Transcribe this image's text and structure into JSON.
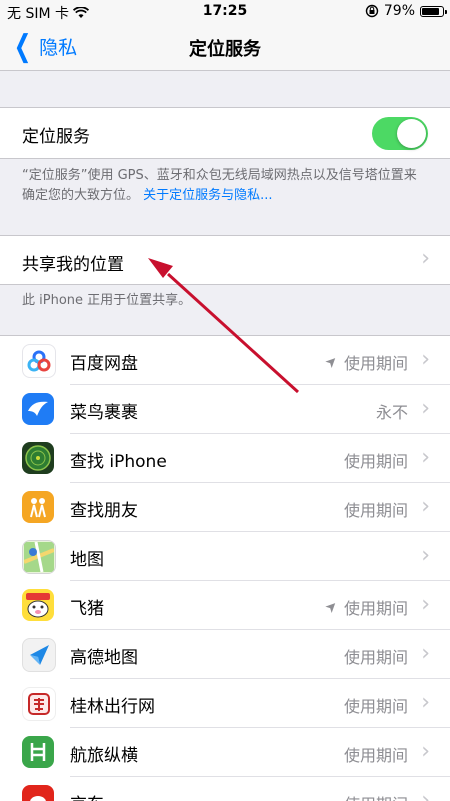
{
  "status_bar": {
    "carrier": "无 SIM 卡",
    "time": "17:25",
    "battery": "79%",
    "battery_level": 0.79
  },
  "nav": {
    "back_label": "隐私",
    "title": "定位服务"
  },
  "location_services": {
    "label": "定位服务",
    "toggle_on": true,
    "footnote": "“定位服务”使用 GPS、蓝牙和众包无线局域网热点以及信号塔位置来确定您的大致方位。",
    "footnote_link": "关于定位服务与隐私..."
  },
  "share_location": {
    "label": "共享我的位置",
    "footnote": "此 iPhone 正用于位置共享。"
  },
  "apps": [
    {
      "name": "百度网盘",
      "value": "使用期间",
      "location_arrow": true,
      "icon": "baidu-netdisk-icon",
      "color": "#ffffff"
    },
    {
      "name": "菜鸟裹裹",
      "value": "永不",
      "location_arrow": false,
      "icon": "cainiao-icon",
      "color": "#1f7cf5"
    },
    {
      "name": "查找 iPhone",
      "value": "使用期间",
      "location_arrow": false,
      "icon": "find-iphone-icon",
      "color": "#2c6e2c"
    },
    {
      "name": "查找朋友",
      "value": "使用期间",
      "location_arrow": false,
      "icon": "find-friends-icon",
      "color": "#f5a623"
    },
    {
      "name": "地图",
      "value": "",
      "location_arrow": false,
      "icon": "maps-icon",
      "color": "#8fd17a"
    },
    {
      "name": "飞猪",
      "value": "使用期间",
      "location_arrow": true,
      "icon": "fliggy-icon",
      "color": "#ffde3b"
    },
    {
      "name": "高德地图",
      "value": "使用期间",
      "location_arrow": false,
      "icon": "amap-icon",
      "color": "#f2f2f2"
    },
    {
      "name": "桂林出行网",
      "value": "使用期间",
      "location_arrow": false,
      "icon": "guilin-travel-icon",
      "color": "#ffffff"
    },
    {
      "name": "航旅纵横",
      "value": "使用期间",
      "location_arrow": false,
      "icon": "umetrip-icon",
      "color": "#3aa64a"
    },
    {
      "name": "京东",
      "value": "使用期间",
      "location_arrow": false,
      "icon": "jd-icon",
      "color": "#e1251b"
    }
  ]
}
